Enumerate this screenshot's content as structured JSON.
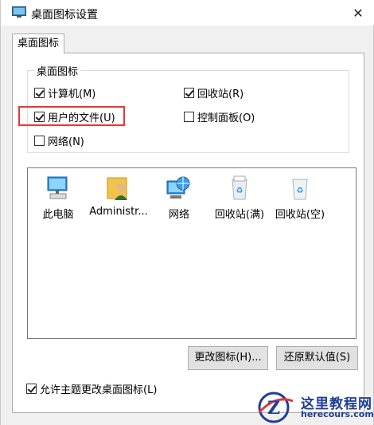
{
  "window": {
    "title": "桌面图标设置",
    "close_glyph": "✕"
  },
  "tab": {
    "label": "桌面图标"
  },
  "group": {
    "legend": "桌面图标",
    "checkboxes": [
      {
        "label": "计算机(M)",
        "checked": true
      },
      {
        "label": "回收站(R)",
        "checked": true
      },
      {
        "label": "用户的文件(U)",
        "checked": true
      },
      {
        "label": "控制面板(O)",
        "checked": false
      },
      {
        "label": "网络(N)",
        "checked": false
      }
    ]
  },
  "icons": [
    {
      "label": "此电脑",
      "icon": "computer-icon"
    },
    {
      "label": "Administr...",
      "icon": "user-folder-icon"
    },
    {
      "label": "网络",
      "icon": "network-icon"
    },
    {
      "label": "回收站(满)",
      "icon": "recycle-bin-full-icon"
    },
    {
      "label": "回收站(空)",
      "icon": "recycle-bin-empty-icon"
    }
  ],
  "buttons": {
    "change_icon": "更改图标(H)...",
    "restore_default": "还原默认值(S)"
  },
  "allow_theme": {
    "label": "允许主题更改桌面图标(L)",
    "checked": true
  },
  "watermark": {
    "title": "这里教程网",
    "url": "herecours.com"
  },
  "colors": {
    "highlight_border": "#e53935",
    "watermark": "#1f3f95"
  }
}
